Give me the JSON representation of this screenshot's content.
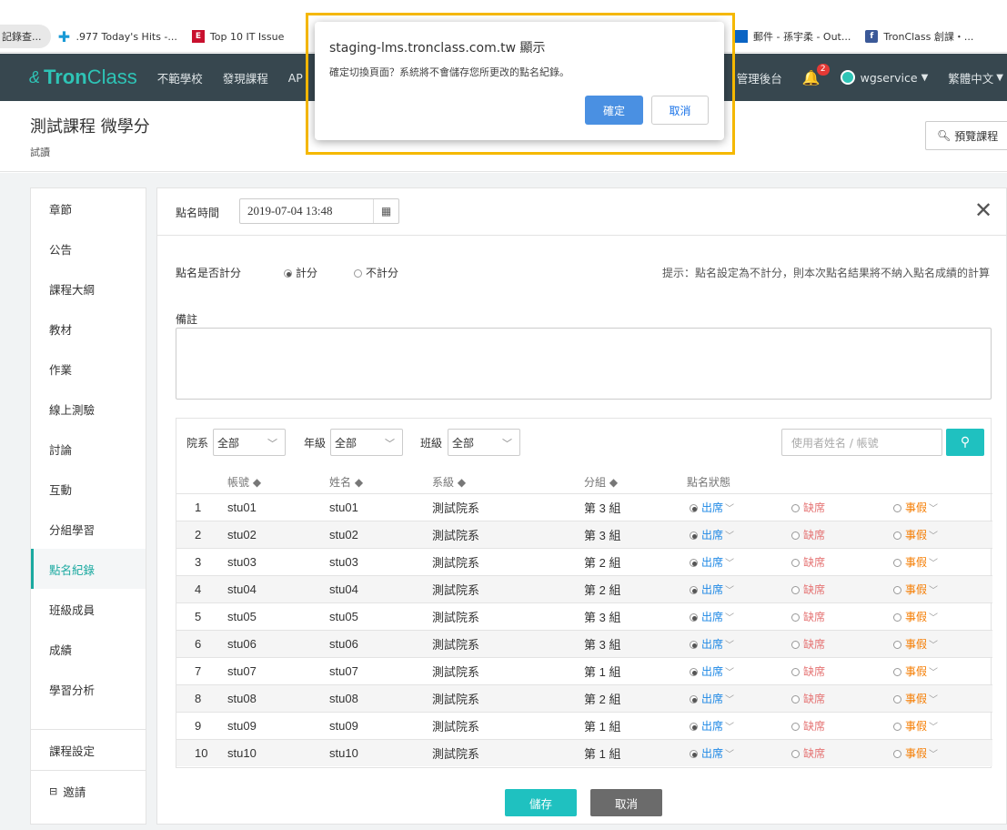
{
  "bookmarks": [
    {
      "icon": "bookmark-folder-icon",
      "label": "記錄查..."
    },
    {
      "icon": "plus-icon",
      "label": ".977 Today's Hits -..."
    },
    {
      "icon": "e-logo-icon",
      "label": "Top 10 IT Issue"
    },
    {
      "icon": "ms-logo-icon",
      "label": "郵件 - 孫宇柔 - Out..."
    },
    {
      "icon": "facebook-icon",
      "label": "TronClass 創課・..."
    }
  ],
  "nav": {
    "logo_prefix": "⚄",
    "logo_bold": "Tron",
    "logo_light": "Class",
    "items": [
      "不範學校",
      "發現課程",
      "AP"
    ],
    "admin": "管理後台",
    "bell_count": "2",
    "user": "wgservice",
    "language": "繁體中文"
  },
  "course": {
    "title": "測試課程 微學分",
    "subtitle": "試讀",
    "preview_label": "預覽課程"
  },
  "sidebar": {
    "items": [
      "章節",
      "公告",
      "課程大綱",
      "教材",
      "作業",
      "線上測驗",
      "討論",
      "互動",
      "分組學習",
      "點名紀錄",
      "班級成員",
      "成績",
      "學習分析"
    ],
    "active": "點名紀錄",
    "bottom_items": [
      "課程設定",
      "邀請"
    ]
  },
  "rollcall": {
    "time_label": "點名時間",
    "time_value": "2019-07-04 13:48",
    "score_label": "點名是否計分",
    "opt_score": "計分",
    "opt_noscore": "不計分",
    "hint": "提示：點名設定為不計分，則本次點名結果將不納入點名成績的計算",
    "remark_label": "備註"
  },
  "filters": {
    "dept_label": "院系",
    "dept_value": "全部",
    "grade_label": "年級",
    "grade_value": "全部",
    "class_label": "班級",
    "class_value": "全部",
    "search_placeholder": "使用者姓名 / 帳號"
  },
  "table": {
    "headers": [
      "帳號 ◆",
      "姓名 ◆",
      "系級 ◆",
      "分組 ◆",
      "點名狀態"
    ],
    "status_labels": {
      "present": "出席",
      "absent": "缺席",
      "leave": "事假"
    },
    "rows": [
      {
        "idx": "1",
        "account": "stu01",
        "name": "stu01",
        "dept": "測試院系",
        "group": "第 3 組"
      },
      {
        "idx": "2",
        "account": "stu02",
        "name": "stu02",
        "dept": "測試院系",
        "group": "第 3 組"
      },
      {
        "idx": "3",
        "account": "stu03",
        "name": "stu03",
        "dept": "測試院系",
        "group": "第 2 組"
      },
      {
        "idx": "4",
        "account": "stu04",
        "name": "stu04",
        "dept": "測試院系",
        "group": "第 2 組"
      },
      {
        "idx": "5",
        "account": "stu05",
        "name": "stu05",
        "dept": "測試院系",
        "group": "第 3 組"
      },
      {
        "idx": "6",
        "account": "stu06",
        "name": "stu06",
        "dept": "測試院系",
        "group": "第 3 組"
      },
      {
        "idx": "7",
        "account": "stu07",
        "name": "stu07",
        "dept": "測試院系",
        "group": "第 1 組"
      },
      {
        "idx": "8",
        "account": "stu08",
        "name": "stu08",
        "dept": "測試院系",
        "group": "第 2 組"
      },
      {
        "idx": "9",
        "account": "stu09",
        "name": "stu09",
        "dept": "測試院系",
        "group": "第 1 組"
      },
      {
        "idx": "10",
        "account": "stu10",
        "name": "stu10",
        "dept": "測試院系",
        "group": "第 1 組"
      }
    ]
  },
  "actions": {
    "save": "儲存",
    "cancel": "取消"
  },
  "dialog": {
    "title": "staging-lms.tronclass.com.tw 顯示",
    "message": "確定切換頁面？系統將不會儲存您所更改的點名紀錄。",
    "ok": "確定",
    "cancel": "取消"
  },
  "colors": {
    "accent": "#1fc1c0",
    "nav_bg": "#37474f",
    "present": "#1e88e5",
    "absent": "#e57373",
    "leave": "#f57c00",
    "highlight": "#f5b800"
  }
}
